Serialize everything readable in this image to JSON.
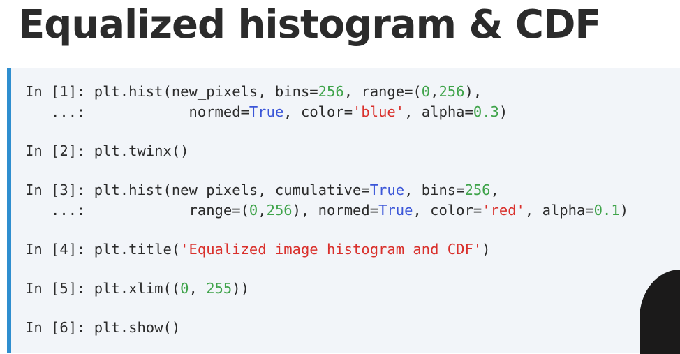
{
  "slide": {
    "title": "Equalized histogram & CDF"
  },
  "cells": [
    {
      "prompt": "In [1]:",
      "lines": [
        [
          {
            "t": "plt.hist(new_pixels, bins=",
            "c": "plain"
          },
          {
            "t": "256",
            "c": "num"
          },
          {
            "t": ", range=(",
            "c": "plain"
          },
          {
            "t": "0",
            "c": "num"
          },
          {
            "t": ",",
            "c": "plain"
          },
          {
            "t": "256",
            "c": "num"
          },
          {
            "t": "),",
            "c": "plain"
          }
        ],
        [
          {
            "t": "           normed=",
            "c": "plain"
          },
          {
            "t": "True",
            "c": "kw"
          },
          {
            "t": ", color=",
            "c": "plain"
          },
          {
            "t": "'blue'",
            "c": "str"
          },
          {
            "t": ", alpha=",
            "c": "plain"
          },
          {
            "t": "0.3",
            "c": "num"
          },
          {
            "t": ")",
            "c": "plain"
          }
        ]
      ],
      "continuation": "   ...:"
    },
    {
      "prompt": "In [2]:",
      "lines": [
        [
          {
            "t": "plt.twinx()",
            "c": "plain"
          }
        ]
      ]
    },
    {
      "prompt": "In [3]:",
      "lines": [
        [
          {
            "t": "plt.hist(new_pixels, cumulative=",
            "c": "plain"
          },
          {
            "t": "True",
            "c": "kw"
          },
          {
            "t": ", bins=",
            "c": "plain"
          },
          {
            "t": "256",
            "c": "num"
          },
          {
            "t": ",",
            "c": "plain"
          }
        ],
        [
          {
            "t": "           range=(",
            "c": "plain"
          },
          {
            "t": "0",
            "c": "num"
          },
          {
            "t": ",",
            "c": "plain"
          },
          {
            "t": "256",
            "c": "num"
          },
          {
            "t": "), normed=",
            "c": "plain"
          },
          {
            "t": "True",
            "c": "kw"
          },
          {
            "t": ", color=",
            "c": "plain"
          },
          {
            "t": "'red'",
            "c": "str"
          },
          {
            "t": ", alpha=",
            "c": "plain"
          },
          {
            "t": "0.1",
            "c": "num"
          },
          {
            "t": ")",
            "c": "plain"
          }
        ]
      ],
      "continuation": "   ...:"
    },
    {
      "prompt": "In [4]:",
      "lines": [
        [
          {
            "t": "plt.title(",
            "c": "plain"
          },
          {
            "t": "'Equalized image histogram and CDF'",
            "c": "str"
          },
          {
            "t": ")",
            "c": "plain"
          }
        ]
      ]
    },
    {
      "prompt": "In [5]:",
      "lines": [
        [
          {
            "t": "plt.xlim((",
            "c": "plain"
          },
          {
            "t": "0",
            "c": "num"
          },
          {
            "t": ", ",
            "c": "plain"
          },
          {
            "t": "255",
            "c": "num"
          },
          {
            "t": "))",
            "c": "plain"
          }
        ]
      ]
    },
    {
      "prompt": "In [6]:",
      "lines": [
        [
          {
            "t": "plt.show()",
            "c": "plain"
          }
        ]
      ]
    }
  ],
  "colors": {
    "accent_bar": "#2f8ecf",
    "panel_bg": "#f2f5f9",
    "keyword": "#3b56d8",
    "number": "#3fa34a",
    "string": "#d9302c"
  }
}
